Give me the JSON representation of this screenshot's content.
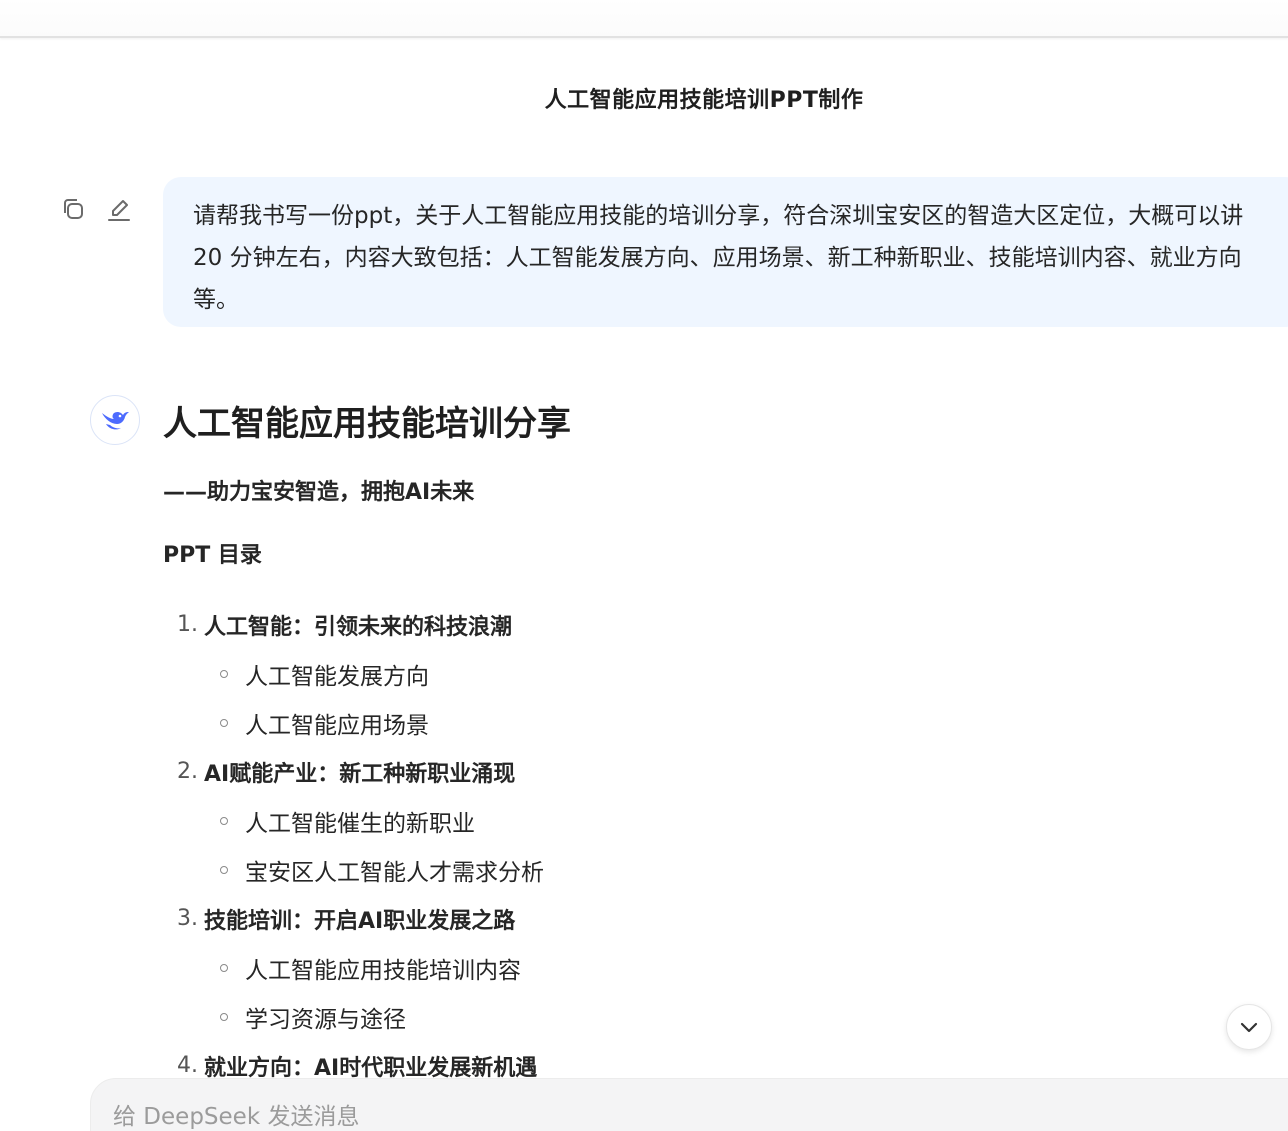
{
  "chat": {
    "title": "人工智能应用技能培训PPT制作"
  },
  "user_message": {
    "text": "请帮我书写一份ppt，关于人工智能应用技能的培训分享，符合深圳宝安区的智造大区定位，大概可以讲20 分钟左右，内容大致包括：人工智能发展方向、应用场景、新工种新职业、技能培训内容、就业方向等。",
    "actions": [
      "copy-icon",
      "edit-icon"
    ]
  },
  "assistant": {
    "avatar_icon": "deepseek-whale-icon",
    "heading": "人工智能应用技能培训分享",
    "subtitle": "——助力宝安智造，拥抱AI未来",
    "toc_label": "PPT 目录",
    "sections": [
      {
        "number": "1.",
        "title": "人工智能：引领未来的科技浪潮",
        "items": [
          "人工智能发展方向",
          "人工智能应用场景"
        ]
      },
      {
        "number": "2.",
        "title": "AI赋能产业：新工种新职业涌现",
        "items": [
          "人工智能催生的新职业",
          "宝安区人工智能人才需求分析"
        ]
      },
      {
        "number": "3.",
        "title": "技能培训：开启AI职业发展之路",
        "items": [
          "人工智能应用技能培训内容",
          "学习资源与途径"
        ]
      },
      {
        "number": "4.",
        "title": "就业方向：AI时代职业发展新机遇",
        "items": []
      }
    ]
  },
  "scroll_button": {
    "icon": "chevron-down-icon"
  },
  "composer": {
    "placeholder": "给 DeepSeek 发送消息",
    "value": ""
  },
  "colors": {
    "user_bubble_bg": "#eff6ff",
    "brand_blue": "#4d6bfe",
    "text": "#262626",
    "composer_bg": "#f4f4f5"
  }
}
